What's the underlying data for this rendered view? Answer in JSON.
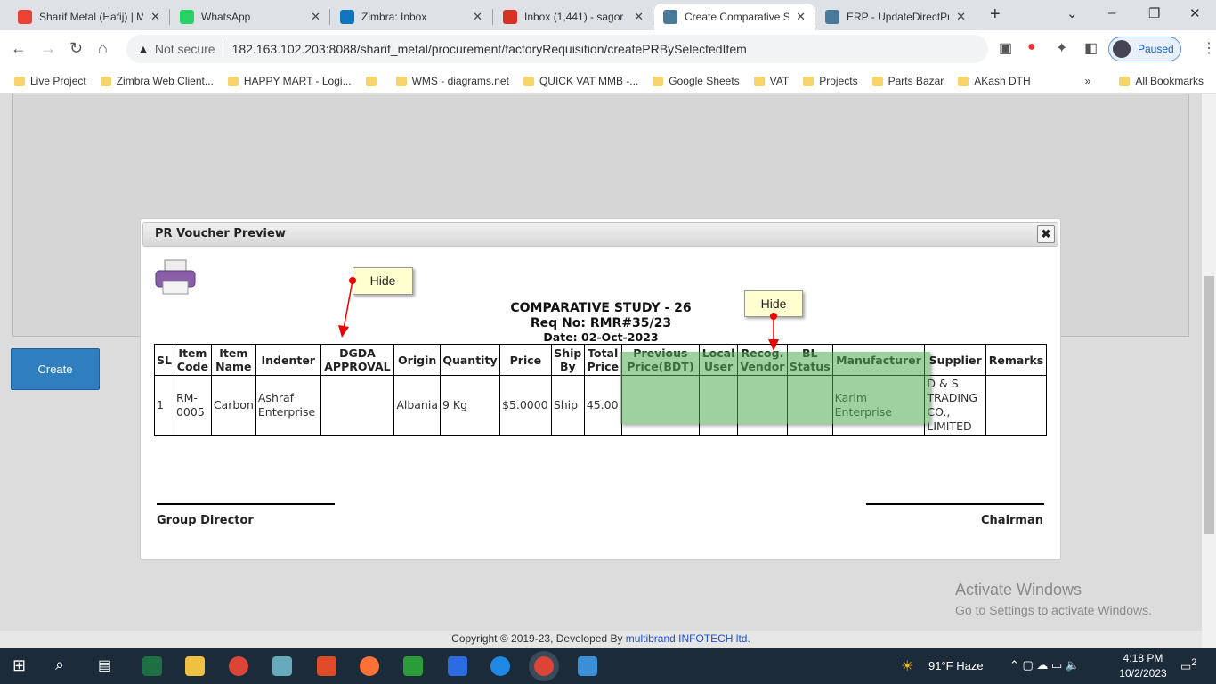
{
  "browser": {
    "tabs": [
      {
        "title": "Sharif Metal (Hafij) | M",
        "icon": "google-icon",
        "color": "#ea4335"
      },
      {
        "title": "WhatsApp",
        "icon": "whatsapp-icon",
        "color": "#25d366"
      },
      {
        "title": "Zimbra: Inbox",
        "icon": "zimbra-icon",
        "color": "#0f75bd"
      },
      {
        "title": "Inbox (1,441) - sagor",
        "icon": "gmail-icon",
        "color": "#d93025"
      },
      {
        "title": "Create Comparative S",
        "icon": "erp-icon",
        "color": "#4a7a9a"
      },
      {
        "title": "ERP - UpdateDirectPu",
        "icon": "erp-icon",
        "color": "#4a7a9a"
      }
    ],
    "not_secure": "Not secure",
    "url": "182.163.102.203:8088/sharif_metal/procurement/factoryRequisition/createPRBySelectedItem",
    "profile_status": "Paused",
    "bookmarks": [
      "Live Project",
      "Zimbra Web Client...",
      "HAPPY MART - Logi...",
      "",
      "WMS - diagrams.net",
      "QUICK VAT MMB -...",
      "Google Sheets",
      "VAT",
      "Projects",
      "Parts Bazar",
      "AKash DTH"
    ],
    "all_bookmarks": "All Bookmarks"
  },
  "page": {
    "create_button": "Create",
    "footer_text": "Copyright © 2019-23, Developed By ",
    "footer_link": "multibrand INFOTECH ltd."
  },
  "modal": {
    "title": "PR Voucher Preview",
    "close": "✖",
    "heading": "COMPARATIVE STUDY - 26",
    "req_no": "Req No: RMR#35/23",
    "date": "Date: 02-Oct-2023",
    "columns": [
      "SL",
      "Item Code",
      "Item Name",
      "Indenter",
      "DGDA APPROVAL",
      "Origin",
      "Quantity",
      "Price",
      "Ship By",
      "Total Price",
      "Previous Price(BDT)",
      "Local User",
      "Recog. Vendor",
      "BL Status",
      "Manufacturer",
      "Supplier",
      "Remarks"
    ],
    "rows": [
      [
        "1",
        "RM-0005",
        "Carbon",
        "Ashraf Enterprise",
        "",
        "Albania",
        "9 Kg",
        "$5.0000",
        "Ship",
        "45.00",
        "",
        "",
        "",
        "",
        "Karim Enterprise",
        "D & S TRADING CO., LIMITED",
        ""
      ]
    ],
    "sign_left": "Group Director",
    "sign_right": "Chairman"
  },
  "annotations": {
    "callout1": "Hide",
    "callout2": "Hide"
  },
  "watermark": {
    "line1": "Activate Windows",
    "line2": "Go to Settings to activate Windows."
  },
  "taskbar": {
    "weather": "91°F  Haze",
    "time": "4:18 PM",
    "date": "10/2/2023",
    "notifications": "2"
  }
}
